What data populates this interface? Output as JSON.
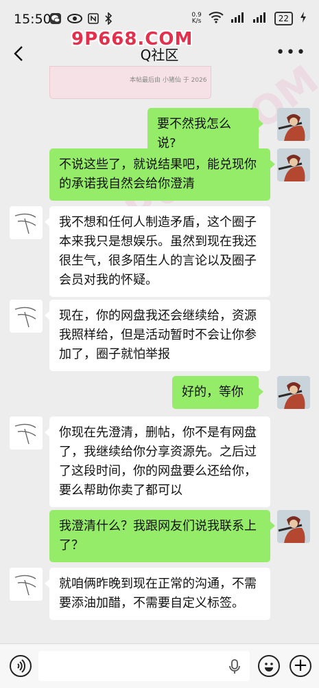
{
  "status_bar": {
    "time": "15:50",
    "net_speed_value": "0.9",
    "net_speed_unit": "K/s",
    "battery": "22"
  },
  "watermark": {
    "logo": "9P668.COM",
    "background": "9P668.COM"
  },
  "nav": {
    "title": "Q社区"
  },
  "pinned_card": {
    "text": "本帖最后由 小猪仙 于 2026"
  },
  "messages": [
    {
      "side": "me",
      "text": "要不然我怎么说?"
    },
    {
      "side": "me",
      "text": "不说这些了，就说结果吧，能兑现你的承诺我自然会给你澄清"
    },
    {
      "side": "other",
      "text": "我不想和任何人制造矛盾，这个圈子本来我只是想娱乐。虽然到现在我还很生气，很多陌生人的言论以及圈子会员对我的怀疑。"
    },
    {
      "side": "other",
      "text": "现在，你的网盘我还会继续给，资源我照样给，但是活动暂时不会让你参加了，圈子就怕举报"
    },
    {
      "side": "me",
      "text": "好的，等你"
    },
    {
      "side": "other",
      "text": "你现在先澄清，删帖，你不是有网盘了，我继续给你分享资源先。之后过了这段时间，你的网盘要么还给你，要么帮助你卖了都可以"
    },
    {
      "side": "me",
      "text": "我澄清什么？我跟网友们说我联系上了？"
    },
    {
      "side": "other",
      "text": "就咱俩昨晚到现在正常的沟通，不需要添油加醋，不需要自定义标签。"
    }
  ],
  "colors": {
    "me_bubble": "#95ec69",
    "other_bubble": "#ffffff",
    "background": "#ededed",
    "logo": "#e3314d"
  },
  "icons": [
    "wechat-icon",
    "eye-icon",
    "nfc-icon",
    "bluetooth-icon",
    "wifi-icon",
    "signal-icon",
    "battery-icon",
    "charging-icon",
    "back-arrow-icon",
    "more-icon",
    "voice-icon",
    "mic-icon",
    "emoji-icon",
    "plus-icon"
  ]
}
